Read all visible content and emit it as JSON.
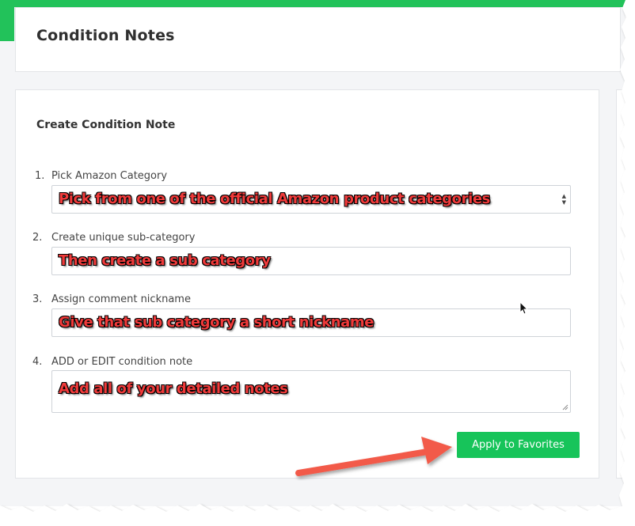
{
  "header": {
    "title": "Condition Notes"
  },
  "form": {
    "title": "Create Condition Note",
    "steps": [
      {
        "number": "1.",
        "label": "Pick Amazon Category",
        "value": "Pick from one of the official Amazon product categories"
      },
      {
        "number": "2.",
        "label": "Create unique sub-category",
        "value": "Then create a sub category"
      },
      {
        "number": "3.",
        "label": "Assign comment nickname",
        "value": "Give that sub category a short nickname"
      },
      {
        "number": "4.",
        "label": "ADD or EDIT condition note",
        "value": "Add all of your detailed notes"
      }
    ],
    "apply_button_label": "Apply to Favorites"
  },
  "colors": {
    "accent": "#22c25a",
    "button": "#17c45a",
    "annotation_text": "#f03a3a",
    "annotation_arrow": "#f25a4a"
  },
  "icons": [
    "select-arrows-icon",
    "resize-grip-icon",
    "annotation-arrow-icon",
    "mouse-cursor-icon"
  ]
}
